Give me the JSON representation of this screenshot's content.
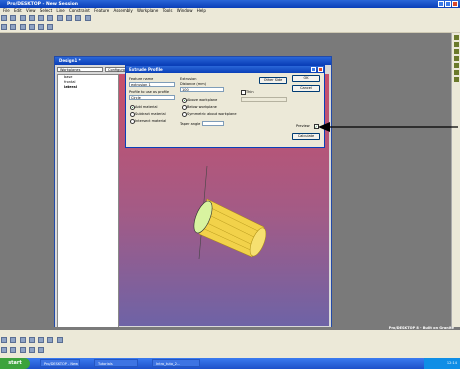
{
  "app": {
    "title": "Pro/DESKTOP - New Session"
  },
  "menu": [
    "File",
    "Edit",
    "View",
    "Select",
    "Line",
    "Constraint",
    "Feature",
    "Assembly",
    "Workplane",
    "Tools",
    "Window",
    "Help"
  ],
  "model_window": {
    "title": "Design1 *",
    "combo_left": "Workplanes",
    "combo_right": "Configurations",
    "tree": [
      "base",
      "frontal",
      "lateral"
    ]
  },
  "dialog": {
    "title": "Extrude Profile",
    "feature_name_label": "Feature name",
    "feature_name_value": "extrusion 1",
    "profile_label": "Profile to use as profile",
    "profile_value": "Circle",
    "material_options": [
      "Add material",
      "Subtract material",
      "Intersect material"
    ],
    "extrusion_label": "Extrusion",
    "distance_label": "Distance (mm)",
    "distance_value": "100",
    "direction_options": [
      "Above workplane",
      "Below workplane",
      "Symmetric about workplane"
    ],
    "taper_label": "Taper angle",
    "thin_label": "Thin",
    "buttons": {
      "other_side": "Other Side",
      "ok": "OK",
      "cancel": "Cancel",
      "preview": "Preview",
      "calculate": "Calculate"
    }
  },
  "status": {
    "text": "Pro/DESKTOP 8 - Built on Granite"
  },
  "taskbar": {
    "start": "start",
    "tasks": [
      "Pro/DESKTOP - New",
      "Tutorials",
      "Intro_tuto_2..."
    ],
    "clock": "12:14"
  },
  "colors": {
    "accent": "#0a3fb8",
    "cylinder": "#f2d24a",
    "viewport_top": "#c8506a",
    "viewport_bottom": "#6e63a6"
  }
}
